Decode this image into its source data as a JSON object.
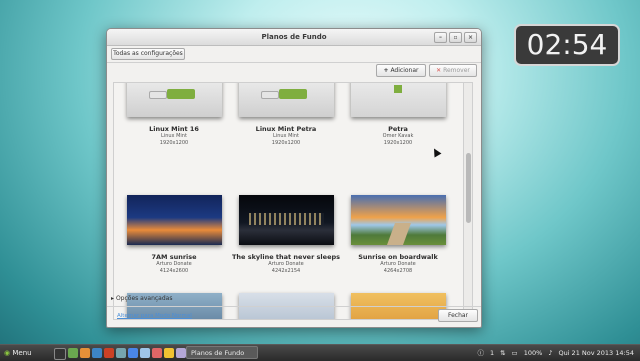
{
  "clock": {
    "time": "02:54"
  },
  "window": {
    "title": "Planos de Fundo",
    "controls": {
      "minimize": "–",
      "maximize": "▫",
      "close": "×"
    },
    "all_settings_label": "Todas as configurações",
    "add_label": "Adicionar",
    "remove_label": "Remover",
    "advanced_options_label": "Opções avançadas",
    "normal_mode_link": "Alternar para Modo Normal",
    "close_label": "Fechar"
  },
  "wallpapers": [
    {
      "name": "Linux Mint 16",
      "author": "Linux Mint",
      "size": "1920x1200"
    },
    {
      "name": "Linux Mint Petra",
      "author": "Linux Mint",
      "size": "1920x1200"
    },
    {
      "name": "Petra",
      "author": "Omer Kavak",
      "size": "1920x1200"
    },
    {
      "name": "7AM sunrise",
      "author": "Arturo Donate",
      "size": "4124x2600"
    },
    {
      "name": "The skyline that never sleeps",
      "author": "Arturo Donate",
      "size": "4242x2154"
    },
    {
      "name": "Sunrise on boardwalk",
      "author": "Arturo Donate",
      "size": "4264x2708"
    }
  ],
  "taskbar": {
    "menu_label": "Menu",
    "task_label": "Planos de Fundo",
    "workspace": "1",
    "battery": "100%",
    "datetime": "Qui 21 Nov 2013 14:54"
  },
  "colors": {
    "accent_link": "#4b8fd8",
    "remove_icon": "#d9534f",
    "add_icon": "#333333"
  }
}
